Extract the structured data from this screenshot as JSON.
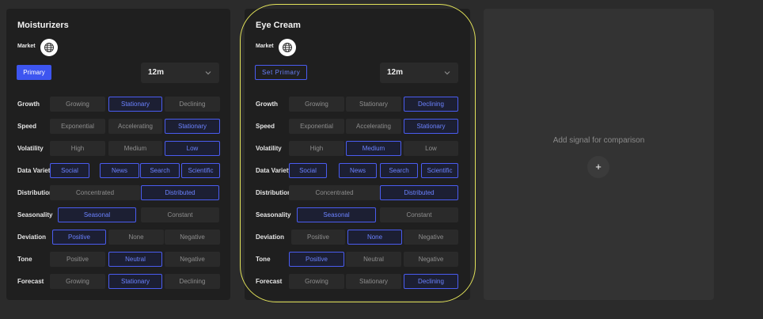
{
  "cards": [
    {
      "title": "Moisturizers",
      "market_label": "Market",
      "primary_label": "Primary",
      "primary_style": "filled",
      "period": "12m",
      "rows": [
        {
          "label": "Growth",
          "options": [
            {
              "t": "Growing",
              "s": false
            },
            {
              "t": "Stationary",
              "s": true
            },
            {
              "t": "Declining",
              "s": false
            }
          ]
        },
        {
          "label": "Speed",
          "options": [
            {
              "t": "Exponential",
              "s": false
            },
            {
              "t": "Accelerating",
              "s": false
            },
            {
              "t": "Stationary",
              "s": true
            }
          ]
        },
        {
          "label": "Volatility",
          "options": [
            {
              "t": "High",
              "s": false
            },
            {
              "t": "Medium",
              "s": false
            },
            {
              "t": "Low",
              "s": true
            }
          ]
        },
        {
          "label": "Data Variety",
          "options": [
            {
              "t": "Social",
              "s": true
            },
            {
              "t": "News",
              "s": true
            },
            {
              "t": "Search",
              "s": true
            },
            {
              "t": "Scientific",
              "s": true
            }
          ]
        },
        {
          "label": "Distribution",
          "options": [
            {
              "t": "Concentrated",
              "s": false
            },
            {
              "t": "Distributed",
              "s": true
            }
          ]
        },
        {
          "label": "Seasonality",
          "options": [
            {
              "t": "Seasonal",
              "s": true
            },
            {
              "t": "Constant",
              "s": false
            }
          ]
        },
        {
          "label": "Deviation",
          "options": [
            {
              "t": "Positive",
              "s": true
            },
            {
              "t": "None",
              "s": false
            },
            {
              "t": "Negative",
              "s": false
            }
          ]
        },
        {
          "label": "Tone",
          "options": [
            {
              "t": "Positive",
              "s": false
            },
            {
              "t": "Neutral",
              "s": true
            },
            {
              "t": "Negative",
              "s": false
            }
          ]
        },
        {
          "label": "Forecast",
          "options": [
            {
              "t": "Growing",
              "s": false
            },
            {
              "t": "Stationary",
              "s": true
            },
            {
              "t": "Declining",
              "s": false
            }
          ]
        }
      ]
    },
    {
      "title": "Eye Cream",
      "market_label": "Market",
      "primary_label": "Set Primary",
      "primary_style": "outline",
      "period": "12m",
      "rows": [
        {
          "label": "Growth",
          "options": [
            {
              "t": "Growing",
              "s": false
            },
            {
              "t": "Stationary",
              "s": false
            },
            {
              "t": "Declining",
              "s": true
            }
          ]
        },
        {
          "label": "Speed",
          "options": [
            {
              "t": "Exponential",
              "s": false
            },
            {
              "t": "Accelerating",
              "s": false
            },
            {
              "t": "Stationary",
              "s": true
            }
          ]
        },
        {
          "label": "Volatility",
          "options": [
            {
              "t": "High",
              "s": false
            },
            {
              "t": "Medium",
              "s": true
            },
            {
              "t": "Low",
              "s": false
            }
          ]
        },
        {
          "label": "Data Variety",
          "options": [
            {
              "t": "Social",
              "s": true
            },
            {
              "t": "News",
              "s": true
            },
            {
              "t": "Search",
              "s": true
            },
            {
              "t": "Scientific",
              "s": true
            }
          ]
        },
        {
          "label": "Distribution",
          "options": [
            {
              "t": "Concentrated",
              "s": false
            },
            {
              "t": "Distributed",
              "s": true
            }
          ]
        },
        {
          "label": "Seasonality",
          "options": [
            {
              "t": "Seasonal",
              "s": true
            },
            {
              "t": "Constant",
              "s": false
            }
          ]
        },
        {
          "label": "Deviation",
          "options": [
            {
              "t": "Positive",
              "s": false
            },
            {
              "t": "None",
              "s": true
            },
            {
              "t": "Negative",
              "s": false
            }
          ]
        },
        {
          "label": "Tone",
          "options": [
            {
              "t": "Positive",
              "s": true
            },
            {
              "t": "Neutral",
              "s": false
            },
            {
              "t": "Negative",
              "s": false
            }
          ]
        },
        {
          "label": "Forecast",
          "options": [
            {
              "t": "Growing",
              "s": false
            },
            {
              "t": "Stationary",
              "s": false
            },
            {
              "t": "Declining",
              "s": true
            }
          ]
        }
      ]
    }
  ],
  "empty_slot": {
    "text": "Add signal for comparison",
    "add_symbol": "+"
  },
  "icons": {
    "market": "globe-icon",
    "period": "chevron-down-icon"
  },
  "colors": {
    "accent": "#3d55f0",
    "selected_text": "#6b82ff",
    "highlight": "#e3e35a"
  }
}
